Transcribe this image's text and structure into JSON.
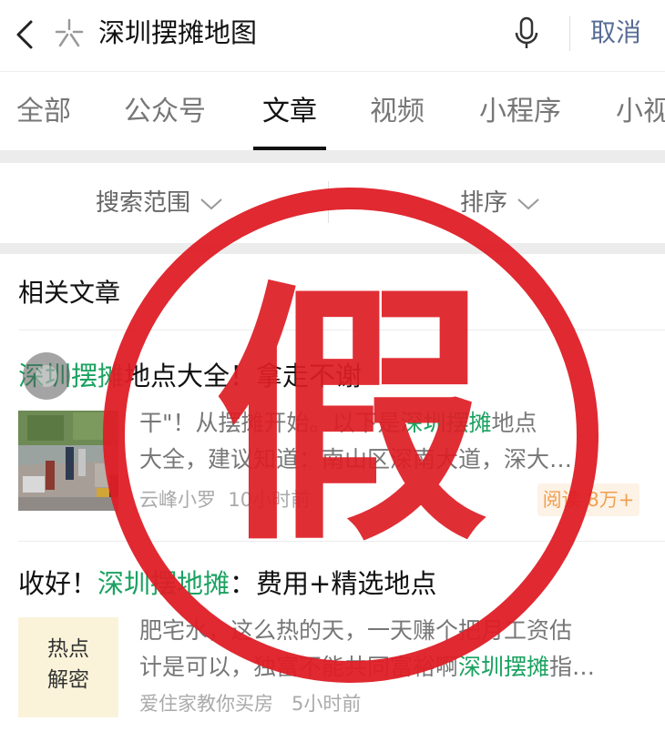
{
  "search": {
    "query": "深圳摆摊地图",
    "cancel_label": "取消"
  },
  "tabs": [
    {
      "label": "全部"
    },
    {
      "label": "公众号"
    },
    {
      "label": "文章",
      "active": true
    },
    {
      "label": "视频"
    },
    {
      "label": "小程序"
    },
    {
      "label": "小视"
    }
  ],
  "filters": {
    "scope_label": "搜索范围",
    "sort_label": "排序"
  },
  "results": {
    "section_title": "相关文章",
    "articles": [
      {
        "title_highlight": "深圳摆摊",
        "title_rest": "地点大全！拿走不谢",
        "snippet_line1_a": "干\"！从摆摊开始。以下是",
        "snippet_line1_hl": "深圳摆摊",
        "snippet_line1_b": "地点",
        "snippet_line2": "大全，建议知道：南山区深南大道，深大…",
        "author": "云峰小罗",
        "time": "10小时前",
        "read_badge": "阅读 8万+"
      },
      {
        "title_prefix": "收好！",
        "title_highlight": "深圳摆地摊",
        "title_rest": "：费用+精选地点",
        "thumb_text_line1": "热点",
        "thumb_text_line2": "解密",
        "snippet_line1": "肥宅水，这么热的天，一天赚个把月工资估",
        "snippet_line2_a": "计是可以，独富不能共同富裕啊",
        "snippet_line2_hl": "深圳摆摊",
        "snippet_line2_b": "指…",
        "author": "爱住家教你买房",
        "time": "5小时前"
      }
    ]
  },
  "watermark": {
    "text": "假",
    "color": "#de1e26"
  },
  "colors": {
    "highlight": "#1aa260",
    "link": "#576b95",
    "badge_text": "#f0a050"
  },
  "icons": [
    "back-arrow-icon",
    "star-icon",
    "microphone-icon",
    "chevron-down-icon"
  ]
}
